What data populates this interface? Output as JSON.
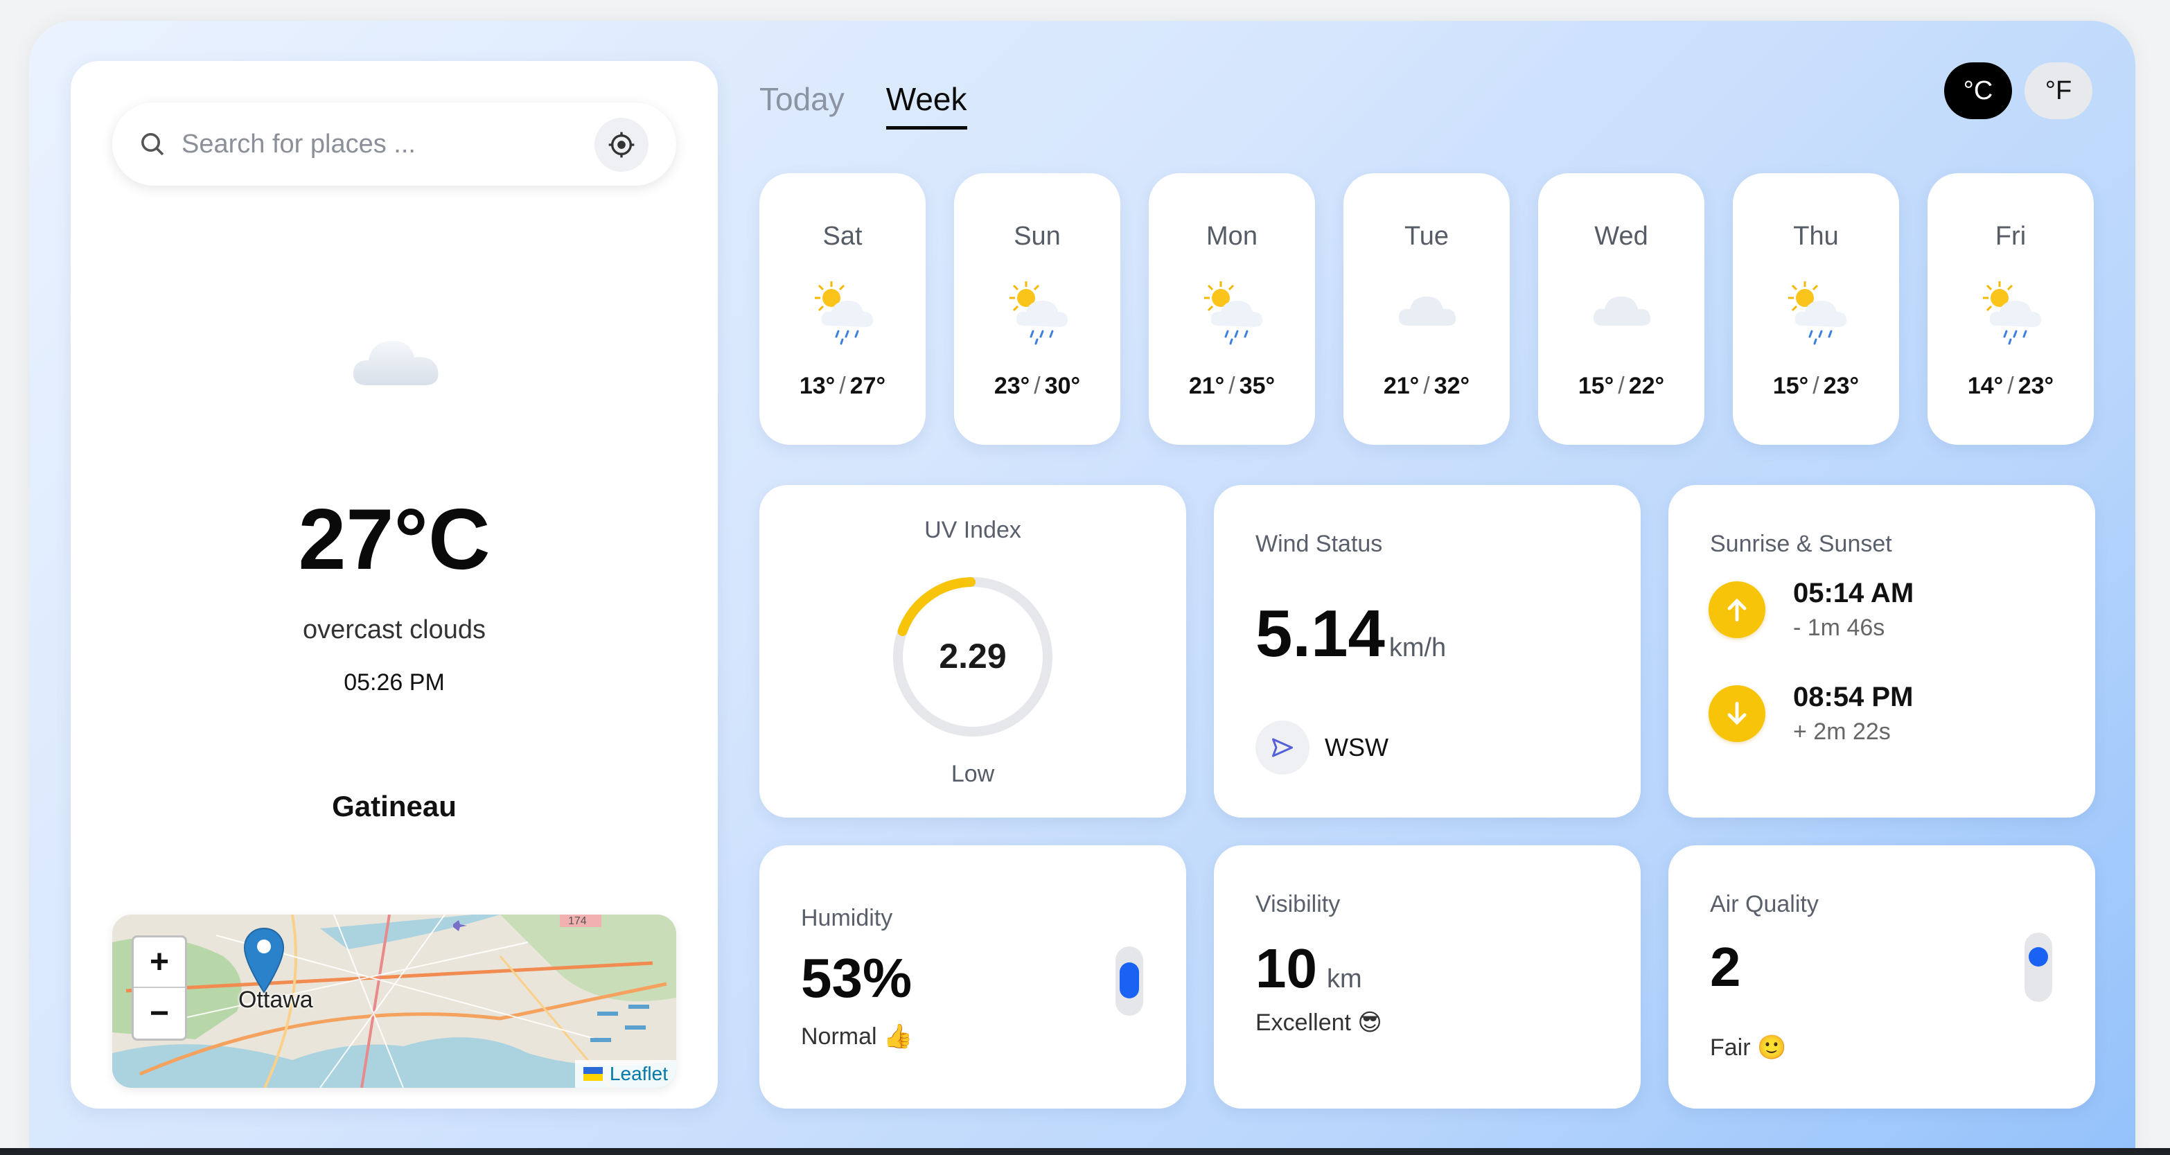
{
  "search": {
    "placeholder": "Search for places ..."
  },
  "current": {
    "temperature": "27°C",
    "description": "overcast clouds",
    "time": "05:26 PM",
    "city": "Gatineau",
    "icon": "cloud-icon"
  },
  "map": {
    "label": "Ottawa",
    "zoom_in": "+",
    "zoom_out": "−",
    "attribution": "Leaflet",
    "marker_icon": "map-marker-icon"
  },
  "tabs": [
    {
      "label": "Today",
      "active": false
    },
    {
      "label": "Week",
      "active": true
    }
  ],
  "units": [
    {
      "label": "°C",
      "active": true
    },
    {
      "label": "°F",
      "active": false
    }
  ],
  "week": [
    {
      "day": "Sat",
      "low": "13°",
      "high": "27°",
      "icon": "sun-cloud-rain-icon"
    },
    {
      "day": "Sun",
      "low": "23°",
      "high": "30°",
      "icon": "sun-cloud-rain-icon"
    },
    {
      "day": "Mon",
      "low": "21°",
      "high": "35°",
      "icon": "sun-cloud-rain-icon"
    },
    {
      "day": "Tue",
      "low": "21°",
      "high": "32°",
      "icon": "cloud-icon"
    },
    {
      "day": "Wed",
      "low": "15°",
      "high": "22°",
      "icon": "cloud-icon"
    },
    {
      "day": "Thu",
      "low": "15°",
      "high": "23°",
      "icon": "sun-cloud-rain-icon"
    },
    {
      "day": "Fri",
      "low": "14°",
      "high": "23°",
      "icon": "sun-cloud-rain-icon"
    }
  ],
  "uv": {
    "title": "UV Index",
    "value": "2.29",
    "label": "Low",
    "fraction": 0.19,
    "color": "#f7c40a"
  },
  "wind": {
    "title": "Wind Status",
    "value": "5.14",
    "unit": "km/h",
    "direction": "WSW",
    "icon": "navigation-arrow-icon"
  },
  "sun": {
    "title": "Sunrise & Sunset",
    "sunrise": "05:14 AM",
    "sunrise_delta": "- 1m 46s",
    "sunset": "08:54 PM",
    "sunset_delta": "+ 2m 22s",
    "color": "#f7c40a"
  },
  "humidity": {
    "title": "Humidity",
    "value": "53%",
    "label": "Normal 👍",
    "level": 0.53
  },
  "visibility": {
    "title": "Visibility",
    "value": "10",
    "unit": "km",
    "label": "Excellent 😎"
  },
  "air": {
    "title": "Air Quality",
    "value": "2",
    "label": "Fair 🙂",
    "level": 0.25
  },
  "accent": "#1962f4"
}
